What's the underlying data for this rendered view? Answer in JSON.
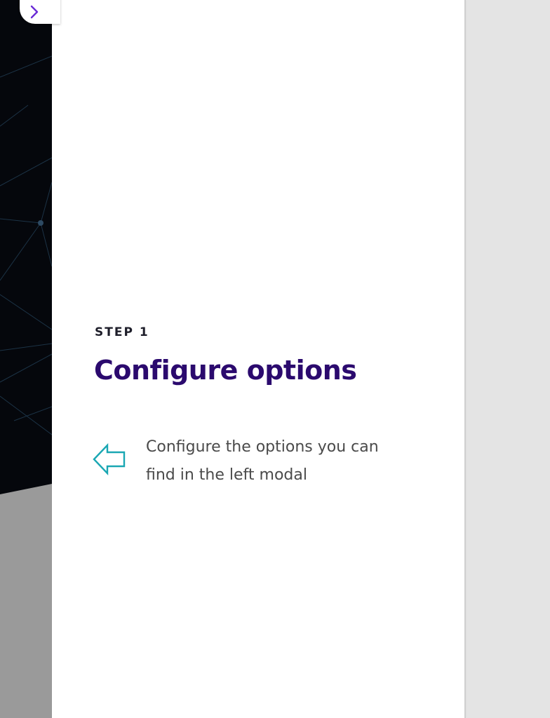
{
  "expand_button": {
    "icon": "chevron-right-icon",
    "color": "#6a2bd6"
  },
  "step": {
    "label": "STEP 1",
    "title": "Configure options",
    "instruction_icon": "arrow-left-outline-icon",
    "instruction_text": "Configure the options you can find in the left modal"
  },
  "colors": {
    "title": "#2b0a6e",
    "accent_teal": "#1aa7b3",
    "left_dark": "#05070c",
    "left_gray": "#9a9a9a",
    "right_gray": "#e4e4e4"
  }
}
